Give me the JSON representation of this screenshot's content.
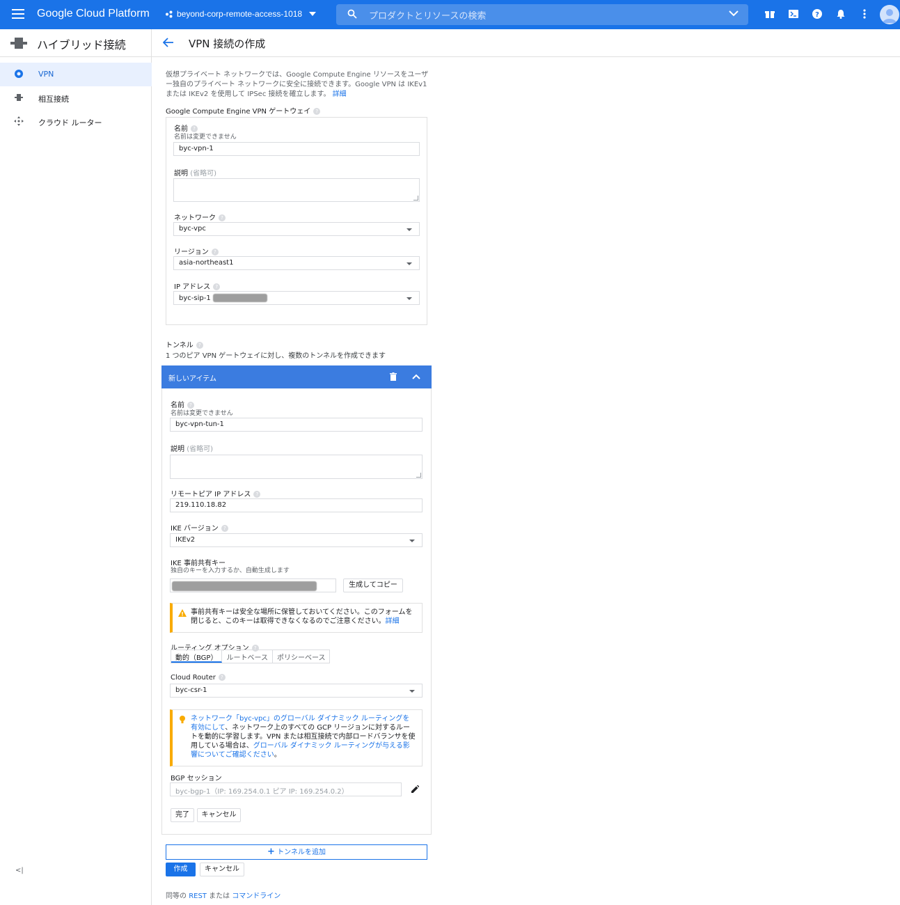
{
  "topbar": {
    "brand": "Google Cloud Platform",
    "project": "beyond-corp-remote-access-1018",
    "search_placeholder": "プロダクトとリソースの検索",
    "icons": [
      "gift-icon",
      "cloud-shell-icon",
      "help-icon",
      "bell-icon",
      "more-vert-icon",
      "avatar"
    ]
  },
  "sidebar": {
    "title": "ハイブリッド接続",
    "items": [
      {
        "label": "VPN",
        "icon": "vpn-globe-icon",
        "active": true
      },
      {
        "label": "相互接続",
        "icon": "interconnect-icon",
        "active": false
      },
      {
        "label": "クラウド ルーター",
        "icon": "router-icon",
        "active": false
      }
    ]
  },
  "header": {
    "title": "VPN 接続の作成"
  },
  "intro": {
    "text": "仮想プライベート ネットワークでは、Google Compute Engine リソースをユーザー独自のプライベート ネットワークに安全に接続できます。Google VPN は IKEv1 または IKEv2 を使用して IPSec 接続を確立します。",
    "link": "詳細"
  },
  "gateway": {
    "section_title": "Google Compute Engine VPN ゲートウェイ",
    "name_label": "名前",
    "name_sub": "名前は変更できません",
    "name_value": "byc-vpn-1",
    "desc_label": "説明",
    "desc_optional": "(省略可)",
    "network_label": "ネットワーク",
    "network_value": "byc-vpc",
    "region_label": "リージョン",
    "region_value": "asia-northeast1",
    "ip_label": "IP アドレス",
    "ip_value": "byc-sip-1"
  },
  "tunnels": {
    "title": "トンネル",
    "subtitle": "1 つのピア VPN ゲートウェイに対し、複数のトンネルを作成できます",
    "item_header": "新しいアイテム",
    "name_label": "名前",
    "name_sub": "名前は変更できません",
    "name_value": "byc-vpn-tun-1",
    "desc_label": "説明",
    "desc_optional": "(省略可)",
    "peer_ip_label": "リモートピア IP アドレス",
    "peer_ip_value": "219.110.18.82",
    "ike_version_label": "IKE バージョン",
    "ike_version_value": "IKEv2",
    "psk_label": "IKE 事前共有キー",
    "psk_sub": "独自のキーを入力するか、自動生成します",
    "generate_button": "生成してコピー",
    "psk_warning": "事前共有キーは安全な場所に保管しておいてください。このフォームを閉じると、このキーは取得できなくなるのでご注意ください。",
    "psk_warning_link": "詳細",
    "routing_label": "ルーティング オプション",
    "routing_options": [
      "動的（BGP）",
      "ルートベース",
      "ポリシーベース"
    ],
    "router_label": "Cloud Router",
    "router_value": "byc-csr-1",
    "info_link1": "ネットワーク「byc-vpc」のグローバル ダイナミック ルーティングを有効にして",
    "info_text": "、ネットワーク上のすべての GCP リージョンに対するルートを動的に学習します。VPN または相互接続で内部ロードバランサを使用している場合は、",
    "info_link2": "グローバル ダイナミック ルーティングが与える影響についてご確認ください",
    "info_end": "。",
    "bgp_label": "BGP セッション",
    "bgp_value": "byc-bgp-1（IP: 169.254.0.1 ピア IP: 169.254.0.2）",
    "done_button": "完了",
    "cancel_button": "キャンセル"
  },
  "add_tunnel_button": "トンネルを追加",
  "create_button": "作成",
  "cancel_button": "キャンセル",
  "footer": {
    "prefix": "同等の ",
    "rest": "REST",
    "middle": " または ",
    "cli": "コマンドライン"
  },
  "colors": {
    "brand_blue": "#1a73e8",
    "tunnel_header": "#3b7ce0",
    "warning": "#f9ab00"
  }
}
